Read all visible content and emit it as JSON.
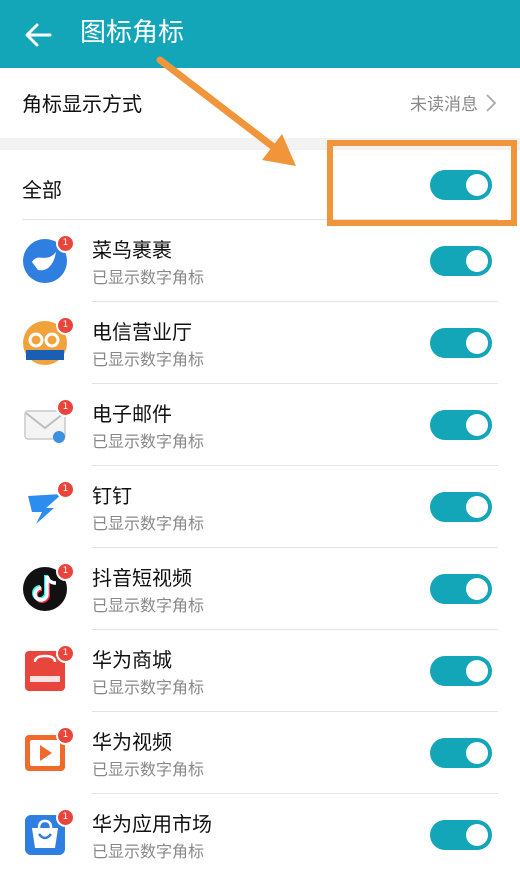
{
  "header": {
    "title": "图标角标",
    "back_icon": "arrow-left-icon",
    "background": "#13a6b8"
  },
  "display": {
    "label": "角标显示方式",
    "value": "未读消息"
  },
  "all": {
    "label": "全部",
    "toggle_on": true
  },
  "apps": [
    {
      "name": "菜鸟裹裹",
      "status": "已显示数字角标",
      "badge": "1",
      "icon": "cainiao-icon",
      "toggle_on": true
    },
    {
      "name": "电信营业厅",
      "status": "已显示数字角标",
      "badge": "1",
      "icon": "telecom-icon",
      "toggle_on": true
    },
    {
      "name": "电子邮件",
      "status": "已显示数字角标",
      "badge": "1",
      "icon": "email-icon",
      "toggle_on": true
    },
    {
      "name": "钉钉",
      "status": "已显示数字角标",
      "badge": "1",
      "icon": "dingtalk-icon",
      "toggle_on": true
    },
    {
      "name": "抖音短视频",
      "status": "已显示数字角标",
      "badge": "1",
      "icon": "douyin-icon",
      "toggle_on": true
    },
    {
      "name": "华为商城",
      "status": "已显示数字角标",
      "badge": "1",
      "icon": "vmall-icon",
      "toggle_on": true
    },
    {
      "name": "华为视频",
      "status": "已显示数字角标",
      "badge": "1",
      "icon": "huawei-video-icon",
      "toggle_on": true
    },
    {
      "name": "华为应用市场",
      "status": "已显示数字角标",
      "badge": "1",
      "icon": "appgallery-icon",
      "toggle_on": true
    }
  ],
  "colors": {
    "accent": "#13a6b8",
    "annotation": "#f0953a",
    "badge": "#e8453c"
  }
}
